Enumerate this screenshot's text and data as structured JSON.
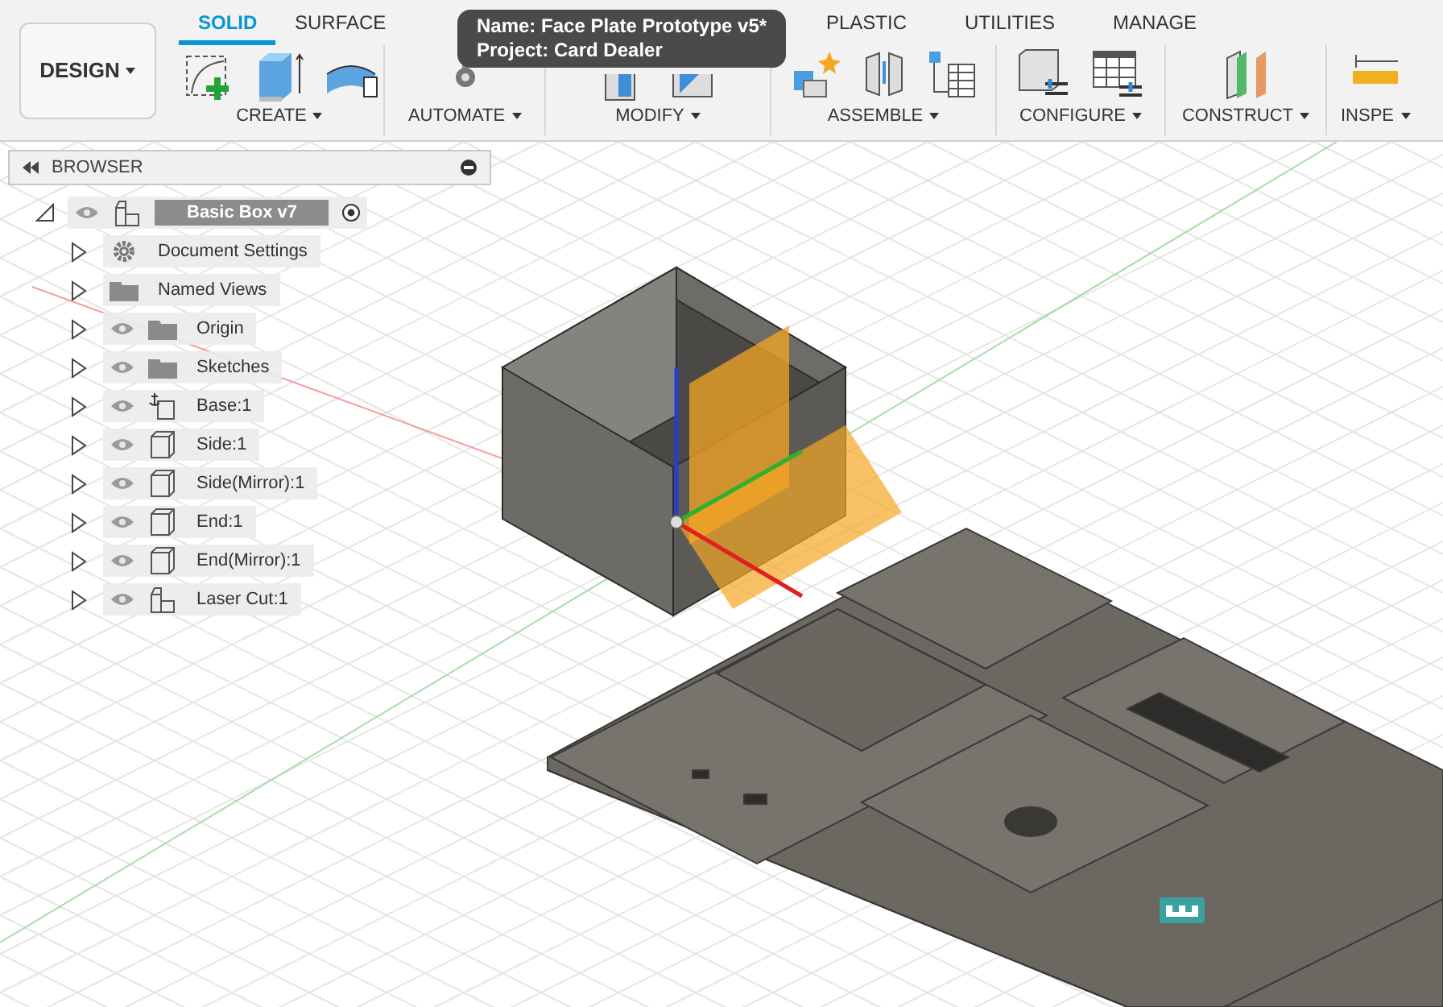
{
  "workspace_button": {
    "label": "DESIGN"
  },
  "tabs": [
    {
      "label": "SOLID",
      "selected": true
    },
    {
      "label": "SURFACE",
      "selected": false
    },
    {
      "label": "PLASTIC",
      "selected": false
    },
    {
      "label": "UTILITIES",
      "selected": false
    },
    {
      "label": "MANAGE",
      "selected": false
    }
  ],
  "tool_groups": [
    {
      "label": "CREATE"
    },
    {
      "label": "AUTOMATE"
    },
    {
      "label": "MODIFY"
    },
    {
      "label": "ASSEMBLE"
    },
    {
      "label": "CONFIGURE"
    },
    {
      "label": "CONSTRUCT"
    },
    {
      "label": "INSPE"
    }
  ],
  "tooltip": {
    "name": "Name: Face Plate Prototype v5*",
    "project": "Project: Card Dealer"
  },
  "browser": {
    "title": "BROWSER",
    "root": {
      "label": "Basic Box v7",
      "expanded": true,
      "children": [
        {
          "label": "Document Settings",
          "kind": "settings",
          "eye": false,
          "expanded": false
        },
        {
          "label": "Named Views",
          "kind": "folder",
          "eye": false,
          "expanded": false
        },
        {
          "label": "Origin",
          "kind": "folder",
          "eye": true,
          "expanded": false
        },
        {
          "label": "Sketches",
          "kind": "folder",
          "eye": true,
          "expanded": false
        },
        {
          "label": "Base:1",
          "kind": "anchored",
          "eye": true,
          "expanded": false
        },
        {
          "label": "Side:1",
          "kind": "body",
          "eye": true,
          "expanded": false
        },
        {
          "label": "Side(Mirror):1",
          "kind": "body",
          "eye": true,
          "expanded": false
        },
        {
          "label": "End:1",
          "kind": "body",
          "eye": true,
          "expanded": false
        },
        {
          "label": "End(Mirror):1",
          "kind": "body",
          "eye": true,
          "expanded": false
        },
        {
          "label": "Laser Cut:1",
          "kind": "component",
          "eye": true,
          "expanded": false
        }
      ]
    }
  }
}
